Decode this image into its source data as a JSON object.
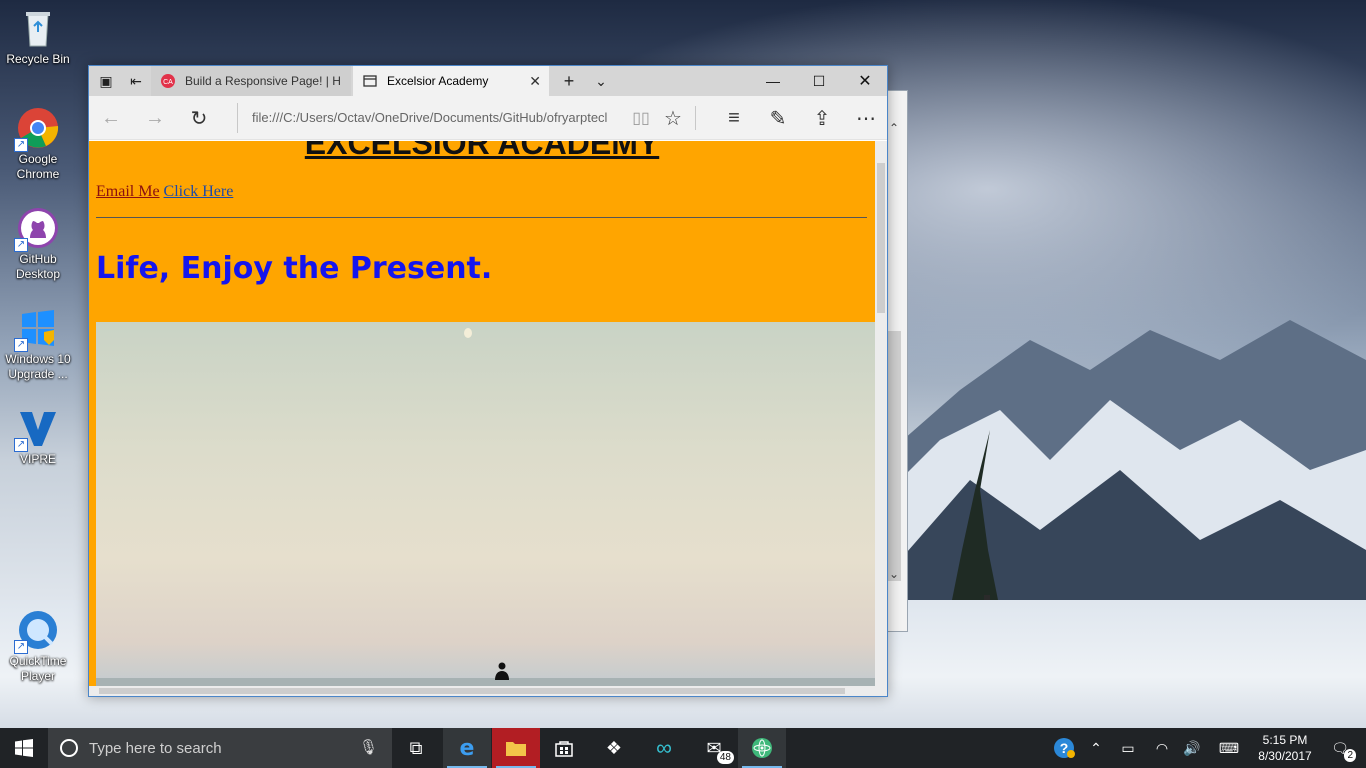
{
  "desktop": {
    "icons": [
      {
        "label": "Recycle Bin",
        "icon": "recycle-bin-icon"
      },
      {
        "label": "Google Chrome",
        "icon": "chrome-icon"
      },
      {
        "label": "GitHub Desktop",
        "icon": "github-icon"
      },
      {
        "label": "Windows 10 Upgrade ...",
        "icon": "windows-upgrade-icon"
      },
      {
        "label": "VIPRE",
        "icon": "vipre-icon"
      },
      {
        "label": "QuickTime Player",
        "icon": "quicktime-icon"
      }
    ]
  },
  "browser": {
    "tabs": [
      {
        "label": "Build a Responsive Page! | H",
        "icon": "codecademy-icon",
        "active": false
      },
      {
        "label": "Excelsior Academy",
        "icon": "page-icon",
        "active": true
      }
    ],
    "address": "file:///C:/Users/Octav/OneDrive/Documents/GitHub/ofryarptecl",
    "accent": "#4b86c9"
  },
  "page": {
    "heading": "EXCELSIOR ACADEMY",
    "link_email": "Email Me",
    "link_click": "Click Here",
    "tagline": "Life, Enjoy the Present.",
    "background_color": "#ffa500",
    "tagline_color": "#1515ee"
  },
  "taskbar": {
    "search_placeholder": "Type here to search",
    "mail_badge": "48",
    "notification_count": "2",
    "time": "5:15 PM",
    "date": "8/30/2017"
  }
}
